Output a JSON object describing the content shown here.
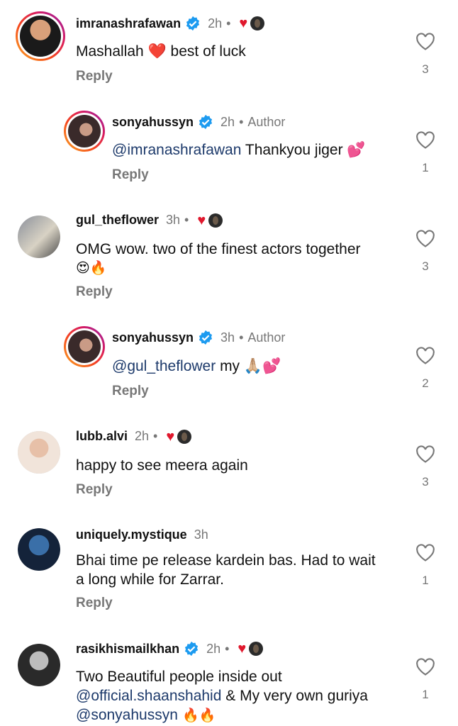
{
  "comments": [
    {
      "username": "imranashrafawan",
      "verified": true,
      "time": "2h",
      "text": "Mashallah ❤️ best of luck",
      "reply": "Reply",
      "likes": "3",
      "author_liked": true
    },
    {
      "username": "sonyahussyn",
      "verified": true,
      "time": "2h",
      "author_label": "Author",
      "mention": "@imranashrafawan",
      "text": " Thankyou jiger 💕",
      "reply": "Reply",
      "likes": "1"
    },
    {
      "username": "gul_theflower",
      "verified": false,
      "time": "3h",
      "text": "OMG wow. two of the finest actors together",
      "text2": "😍🔥",
      "reply": "Reply",
      "likes": "3",
      "author_liked": true
    },
    {
      "username": "sonyahussyn",
      "verified": true,
      "time": "3h",
      "author_label": "Author",
      "mention": "@gul_theflower",
      "text": " my 🙏🏼💕",
      "reply": "Reply",
      "likes": "2"
    },
    {
      "username": "lubb.alvi",
      "verified": false,
      "time": "2h",
      "text": "happy to see meera again",
      "reply": "Reply",
      "likes": "3",
      "author_liked": true
    },
    {
      "username": "uniquely.mystique",
      "verified": false,
      "time": "3h",
      "text": "Bhai time pe release kardein bas. Had to wait",
      "text2": "a long while for Zarrar.",
      "reply": "Reply",
      "likes": "1"
    },
    {
      "username": "rasikhismailkhan",
      "verified": true,
      "time": "2h",
      "text": "Two Beautiful people inside out",
      "mention2": "@official.shaanshahid",
      "text2": " & My very own guriya",
      "mention3": "@sonyahussyn",
      "text3": " 🔥🔥",
      "likes": "1",
      "author_liked": true
    }
  ],
  "separator": "•",
  "colors": {
    "like_heart": "#e0182d",
    "verified": "#1d9bf0",
    "mention": "#1d3a6b",
    "muted": "#777777"
  }
}
